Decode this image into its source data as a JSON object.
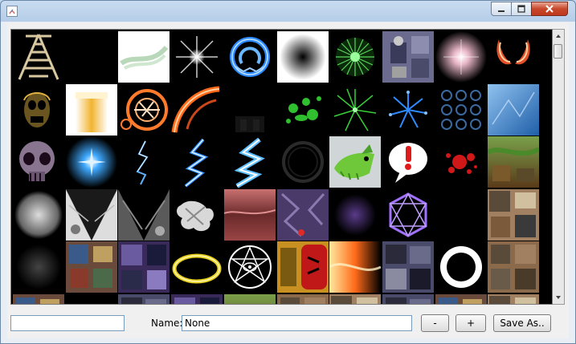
{
  "window": {
    "controls": {
      "minimize_icon": "minimize-icon",
      "maximize_icon": "maximize-icon",
      "close_icon": "close-icon"
    }
  },
  "gallery": {
    "thumbnails": [
      {
        "icon": "rope-ladder"
      },
      {
        "icon": "empty"
      },
      {
        "icon": "green-wisp"
      },
      {
        "icon": "white-flare"
      },
      {
        "icon": "blue-rune-ring"
      },
      {
        "icon": "radial-gradient"
      },
      {
        "icon": "green-burst"
      },
      {
        "icon": "character-sprite"
      },
      {
        "icon": "pink-flare"
      },
      {
        "icon": "red-claws"
      },
      {
        "icon": "yellow-skull"
      },
      {
        "icon": "beer-glass"
      },
      {
        "icon": "orange-rune-circle"
      },
      {
        "icon": "fire-arc"
      },
      {
        "icon": "dark-pillar"
      },
      {
        "icon": "green-splatter"
      },
      {
        "icon": "green-firework"
      },
      {
        "icon": "blue-particles"
      },
      {
        "icon": "blue-rings"
      },
      {
        "icon": "ice-texture"
      },
      {
        "icon": "purple-skull"
      },
      {
        "icon": "blue-energy-ball"
      },
      {
        "icon": "lightning-small"
      },
      {
        "icon": "lightning-blue"
      },
      {
        "icon": "lightning-bright"
      },
      {
        "icon": "dark-ring"
      },
      {
        "icon": "green-creature"
      },
      {
        "icon": "exclamation-bubble"
      },
      {
        "icon": "red-splatter"
      },
      {
        "icon": "jungle-tiles"
      },
      {
        "icon": "white-glow"
      },
      {
        "icon": "rock-wedge-light"
      },
      {
        "icon": "rock-wedge-dark"
      },
      {
        "icon": "white-smoke"
      },
      {
        "icon": "red-rock-texture"
      },
      {
        "icon": "purple-cave"
      },
      {
        "icon": "purple-orb"
      },
      {
        "icon": "purple-hexagram"
      },
      {
        "icon": "empty"
      },
      {
        "icon": "tile-sheet"
      },
      {
        "icon": "dark-smoke"
      },
      {
        "icon": "temple-tiles"
      },
      {
        "icon": "purple-tiles"
      },
      {
        "icon": "yellow-ring"
      },
      {
        "icon": "eye-pentagram"
      },
      {
        "icon": "red-face-panel"
      },
      {
        "icon": "fire-streak"
      },
      {
        "icon": "castle-tiles"
      },
      {
        "icon": "black-hole"
      },
      {
        "icon": "wood-tiles"
      }
    ]
  },
  "footer": {
    "left_field_value": "",
    "name_label": "Name:",
    "name_value": "None",
    "minus_label": "-",
    "plus_label": "+",
    "save_label": "Save As.."
  },
  "colors": {
    "title_bar": "#b5cde8",
    "close_button": "#c8482c",
    "gallery_bg": "#000000"
  }
}
